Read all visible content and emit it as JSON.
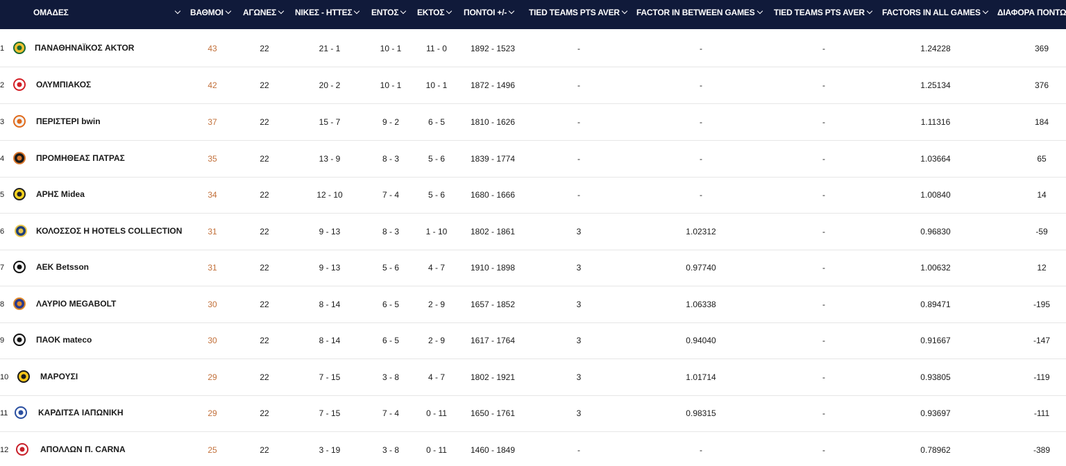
{
  "header": {
    "team": "ΟΜΑΔΕΣ",
    "points": "ΒΑΘΜΟΙ",
    "games": "ΑΓΩΝΕΣ",
    "wl": "ΝΙΚΕΣ - ΗΤΤΕΣ",
    "home": "ΕΝΤΟΣ",
    "away": "ΕΚΤΟΣ",
    "pointsdiff": "ΠΟΝΤΟΙ +/-",
    "tied1": "TIED TEAMS PTS AVER",
    "factor_between": "FACTOR IN BETWEEN GAMES",
    "tied2": "TIED TEAMS PTS AVER",
    "factors_all": "FACTORS IN ALL GAMES",
    "diff": "ΔΙΑΦΟΡΑ ΠΟΝΤΩΝ"
  },
  "colors": {
    "header_bg": "#101a3a",
    "points_accent": "#c2703a"
  },
  "rows": [
    {
      "pos": "1",
      "team": "ΠΑΝΑΘΗΝΑΪΚΟΣ AKTOR",
      "logo": "panathinaikos-logo",
      "pts": "43",
      "games": "22",
      "wl": "21 - 1",
      "home": "10 - 1",
      "away": "11 - 0",
      "pf": "1892 - 1523",
      "tied1": "-",
      "factor": "-",
      "tied2": "-",
      "factors_all": "1.24228",
      "diff": "369"
    },
    {
      "pos": "2",
      "team": "ΟΛΥΜΠΙΑΚΟΣ",
      "logo": "olympiacos-logo",
      "pts": "42",
      "games": "22",
      "wl": "20 - 2",
      "home": "10 - 1",
      "away": "10 - 1",
      "pf": "1872 - 1496",
      "tied1": "-",
      "factor": "-",
      "tied2": "-",
      "factors_all": "1.25134",
      "diff": "376"
    },
    {
      "pos": "3",
      "team": "ΠΕΡΙΣΤΕΡΙ bwin",
      "logo": "peristeri-logo",
      "pts": "37",
      "games": "22",
      "wl": "15 - 7",
      "home": "9 - 2",
      "away": "6 - 5",
      "pf": "1810 - 1626",
      "tied1": "-",
      "factor": "-",
      "tied2": "-",
      "factors_all": "1.11316",
      "diff": "184"
    },
    {
      "pos": "4",
      "team": "ΠΡΟΜΗΘΕΑΣ ΠΑΤΡΑΣ",
      "logo": "promitheas-logo",
      "pts": "35",
      "games": "22",
      "wl": "13 - 9",
      "home": "8 - 3",
      "away": "5 - 6",
      "pf": "1839 - 1774",
      "tied1": "-",
      "factor": "-",
      "tied2": "-",
      "factors_all": "1.03664",
      "diff": "65"
    },
    {
      "pos": "5",
      "team": "ΑΡΗΣ Midea",
      "logo": "aris-logo",
      "pts": "34",
      "games": "22",
      "wl": "12 - 10",
      "home": "7 - 4",
      "away": "5 - 6",
      "pf": "1680 - 1666",
      "tied1": "-",
      "factor": "-",
      "tied2": "-",
      "factors_all": "1.00840",
      "diff": "14"
    },
    {
      "pos": "6",
      "team": "ΚΟΛΟΣΣΟΣ H HOTELS COLLECTION",
      "logo": "kolossos-logo",
      "pts": "31",
      "games": "22",
      "wl": "9 - 13",
      "home": "8 - 3",
      "away": "1 - 10",
      "pf": "1802 - 1861",
      "tied1": "3",
      "factor": "1.02312",
      "tied2": "-",
      "factors_all": "0.96830",
      "diff": "-59"
    },
    {
      "pos": "7",
      "team": "AEK Betsson",
      "logo": "aek-logo",
      "pts": "31",
      "games": "22",
      "wl": "9 - 13",
      "home": "5 - 6",
      "away": "4 - 7",
      "pf": "1910 - 1898",
      "tied1": "3",
      "factor": "0.97740",
      "tied2": "-",
      "factors_all": "1.00632",
      "diff": "12"
    },
    {
      "pos": "8",
      "team": "ΛΑΥΡΙΟ MEGABOLT",
      "logo": "lavrio-logo",
      "pts": "30",
      "games": "22",
      "wl": "8 - 14",
      "home": "6 - 5",
      "away": "2 - 9",
      "pf": "1657 - 1852",
      "tied1": "3",
      "factor": "1.06338",
      "tied2": "-",
      "factors_all": "0.89471",
      "diff": "-195"
    },
    {
      "pos": "9",
      "team": "ΠΑΟΚ mateco",
      "logo": "paok-logo",
      "pts": "30",
      "games": "22",
      "wl": "8 - 14",
      "home": "6 - 5",
      "away": "2 - 9",
      "pf": "1617 - 1764",
      "tied1": "3",
      "factor": "0.94040",
      "tied2": "-",
      "factors_all": "0.91667",
      "diff": "-147"
    },
    {
      "pos": "10",
      "team": "ΜΑΡΟΥΣΙ",
      "logo": "maroussi-logo",
      "pts": "29",
      "games": "22",
      "wl": "7 - 15",
      "home": "3 - 8",
      "away": "4 - 7",
      "pf": "1802 - 1921",
      "tied1": "3",
      "factor": "1.01714",
      "tied2": "-",
      "factors_all": "0.93805",
      "diff": "-119"
    },
    {
      "pos": "11",
      "team": "ΚΑΡΔΙΤΣΑ ΙΑΠΩΝΙΚΗ",
      "logo": "karditsa-logo",
      "pts": "29",
      "games": "22",
      "wl": "7 - 15",
      "home": "7 - 4",
      "away": "0 - 11",
      "pf": "1650 - 1761",
      "tied1": "3",
      "factor": "0.98315",
      "tied2": "-",
      "factors_all": "0.93697",
      "diff": "-111"
    },
    {
      "pos": "12",
      "team": "ΑΠΟΛΛΩΝ Π. CARNA",
      "logo": "apollon-logo",
      "pts": "25",
      "games": "22",
      "wl": "3 - 19",
      "home": "3 - 8",
      "away": "0 - 11",
      "pf": "1460 - 1849",
      "tied1": "-",
      "factor": "-",
      "tied2": "-",
      "factors_all": "0.78962",
      "diff": "-389"
    }
  ]
}
